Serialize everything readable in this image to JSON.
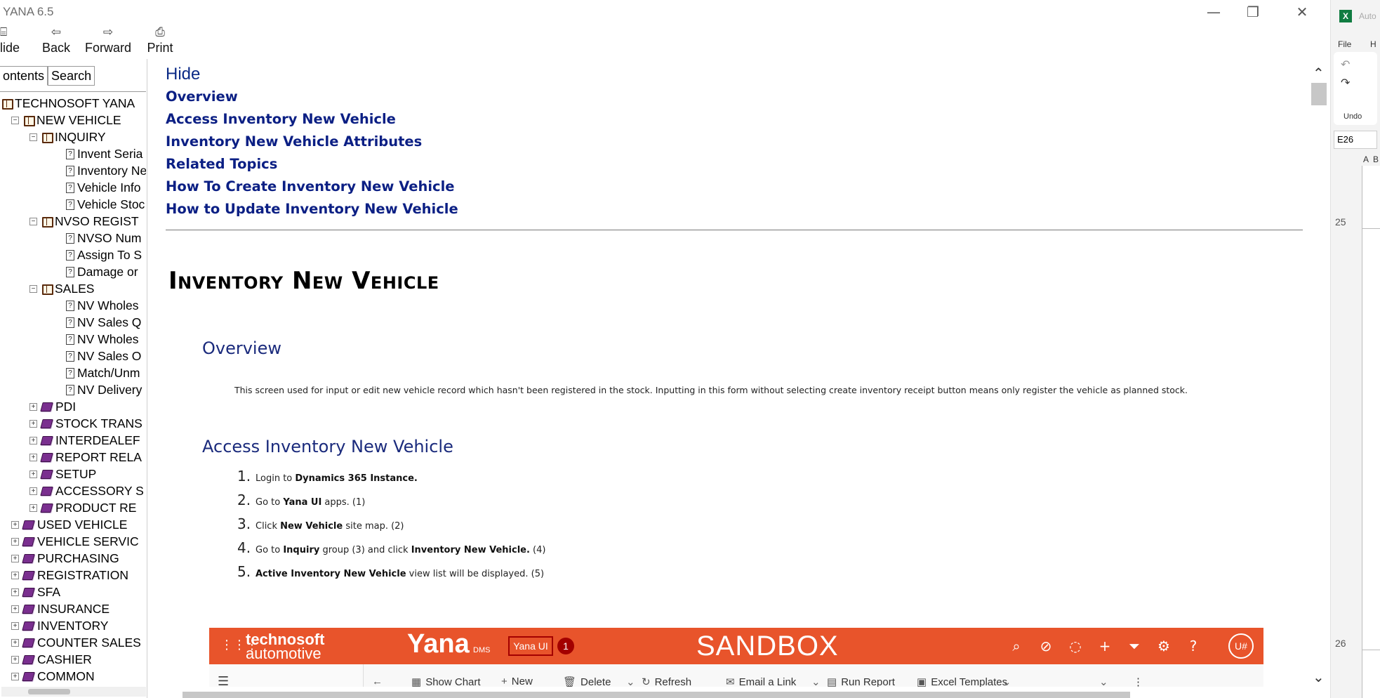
{
  "window": {
    "title": "YANA 6.5",
    "minimize": "—",
    "restore": "❐",
    "close": "✕"
  },
  "toolbar": {
    "hide": {
      "label": "lide",
      "icon": "⌸"
    },
    "back": {
      "label": "Back",
      "icon": "⇦"
    },
    "forward": {
      "label": "Forward",
      "icon": "⇨"
    },
    "print": {
      "label": "Print",
      "icon": "⎙"
    }
  },
  "nav": {
    "tabs": [
      "ontents",
      "Search"
    ],
    "tree": [
      {
        "label": "TECHNOSOFT YANA",
        "level": 0,
        "kind": "open",
        "exp": ""
      },
      {
        "label": "NEW VEHICLE",
        "level": 1,
        "kind": "open",
        "exp": "−"
      },
      {
        "label": "INQUIRY",
        "level": 2,
        "kind": "open",
        "exp": "−"
      },
      {
        "label": "Invent Seria",
        "level": 3,
        "kind": "page",
        "exp": ""
      },
      {
        "label": "Inventory Ne",
        "level": 3,
        "kind": "page",
        "exp": ""
      },
      {
        "label": "Vehicle Info",
        "level": 3,
        "kind": "page",
        "exp": ""
      },
      {
        "label": "Vehicle Stoc",
        "level": 3,
        "kind": "page",
        "exp": ""
      },
      {
        "label": "NVSO REGIST",
        "level": 2,
        "kind": "open",
        "exp": "−"
      },
      {
        "label": "NVSO Num",
        "level": 3,
        "kind": "page",
        "exp": ""
      },
      {
        "label": "Assign To S",
        "level": 3,
        "kind": "page",
        "exp": ""
      },
      {
        "label": "Damage or",
        "level": 3,
        "kind": "page",
        "exp": ""
      },
      {
        "label": "SALES",
        "level": 2,
        "kind": "open",
        "exp": "−"
      },
      {
        "label": "NV Wholes",
        "level": 3,
        "kind": "page",
        "exp": ""
      },
      {
        "label": "NV Sales Q",
        "level": 3,
        "kind": "page",
        "exp": ""
      },
      {
        "label": "NV Wholes",
        "level": 3,
        "kind": "page",
        "exp": ""
      },
      {
        "label": "NV Sales O",
        "level": 3,
        "kind": "page",
        "exp": ""
      },
      {
        "label": "Match/Unm",
        "level": 3,
        "kind": "page",
        "exp": ""
      },
      {
        "label": "NV Delivery",
        "level": 3,
        "kind": "page",
        "exp": ""
      },
      {
        "label": "PDI",
        "level": 2,
        "kind": "closed",
        "exp": "+"
      },
      {
        "label": "STOCK TRANS",
        "level": 2,
        "kind": "closed",
        "exp": "+"
      },
      {
        "label": "INTERDEALEF",
        "level": 2,
        "kind": "closed",
        "exp": "+"
      },
      {
        "label": "REPORT RELA",
        "level": 2,
        "kind": "closed",
        "exp": "+"
      },
      {
        "label": "SETUP",
        "level": 2,
        "kind": "closed",
        "exp": "+"
      },
      {
        "label": "ACCESSORY S",
        "level": 2,
        "kind": "closed",
        "exp": "+"
      },
      {
        "label": "PRODUCT RE",
        "level": 2,
        "kind": "closed",
        "exp": "+"
      },
      {
        "label": "USED VEHICLE",
        "level": 1,
        "kind": "closed",
        "exp": "+"
      },
      {
        "label": "VEHICLE SERVIC",
        "level": 1,
        "kind": "closed",
        "exp": "+"
      },
      {
        "label": "PURCHASING",
        "level": 1,
        "kind": "closed",
        "exp": "+"
      },
      {
        "label": "REGISTRATION",
        "level": 1,
        "kind": "closed",
        "exp": "+"
      },
      {
        "label": "SFA",
        "level": 1,
        "kind": "closed",
        "exp": "+"
      },
      {
        "label": "INSURANCE",
        "level": 1,
        "kind": "closed",
        "exp": "+"
      },
      {
        "label": "INVENTORY",
        "level": 1,
        "kind": "closed",
        "exp": "+"
      },
      {
        "label": "COUNTER SALES",
        "level": 1,
        "kind": "closed",
        "exp": "+"
      },
      {
        "label": "CASHIER",
        "level": 1,
        "kind": "closed",
        "exp": "+"
      },
      {
        "label": "COMMON",
        "level": 1,
        "kind": "closed",
        "exp": "+"
      }
    ]
  },
  "content": {
    "hide_link": "Hide",
    "toc": [
      "Overview",
      "Access Inventory New Vehicle",
      "Inventory New Vehicle Attributes",
      "Related Topics",
      "How To Create Inventory New Vehicle",
      "How to Update Inventory New Vehicle"
    ],
    "page_title": "Inventory New Vehicle",
    "overview_heading": "Overview",
    "overview_text": "This screen used for input or edit new vehicle record which hasn't been registered in the stock. Inputting in this form without selecting create inventory receipt button means only register the  vehicle as planned stock.",
    "access_heading": "Access Inventory New Vehicle",
    "steps": [
      {
        "num": "1.",
        "parts": [
          {
            "t": "Login to ",
            "b": false
          },
          {
            "t": "Dynamics 365 Instance.",
            "b": true
          }
        ]
      },
      {
        "num": "2.",
        "parts": [
          {
            "t": "Go to ",
            "b": false
          },
          {
            "t": "Yana UI",
            "b": true
          },
          {
            "t": " apps. (1)",
            "b": false
          }
        ]
      },
      {
        "num": "3.",
        "parts": [
          {
            "t": "Click ",
            "b": false
          },
          {
            "t": "New Vehicle",
            "b": true
          },
          {
            "t": " site map. (2)",
            "b": false
          }
        ]
      },
      {
        "num": "4.",
        "parts": [
          {
            "t": "Go to  ",
            "b": false
          },
          {
            "t": "Inquiry",
            "b": true
          },
          {
            "t": " group (3) and click ",
            "b": false
          },
          {
            "t": "Inventory New Vehicle.",
            "b": true
          },
          {
            "t": " (4)",
            "b": false
          }
        ]
      },
      {
        "num": "5.",
        "parts": [
          {
            "t": "Active Inventory New Vehicle",
            "b": true
          },
          {
            "t": " view list will be displayed. (5)",
            "b": false
          }
        ]
      }
    ]
  },
  "embedded_app": {
    "brand_line1": "technosoft",
    "brand_line2": "automotive",
    "brand_name": "Yana",
    "brand_suffix": "DMS",
    "app_chip": "Yana UI",
    "chip_badge": "1",
    "environment": "SANDBOX",
    "avatar": "U#",
    "commands": [
      {
        "label": "Show Chart",
        "icon": "▦"
      },
      {
        "label": "New",
        "icon": "+"
      },
      {
        "label": "Delete",
        "icon": "🗑"
      },
      {
        "label": "Refresh",
        "icon": "↻"
      },
      {
        "label": "Email a Link",
        "icon": "✉"
      },
      {
        "label": "Run Report",
        "icon": "▤"
      },
      {
        "label": "Excel Templates",
        "icon": "▣"
      }
    ],
    "accent_color": "#e8542b"
  },
  "excel": {
    "logo": "X",
    "tab_file": "File",
    "tab_h": "H",
    "undo_label": "Undo",
    "name_box": "E26",
    "col_a": "A",
    "col_b": "B",
    "rows": [
      "25",
      "26"
    ],
    "auto": "Auto"
  }
}
